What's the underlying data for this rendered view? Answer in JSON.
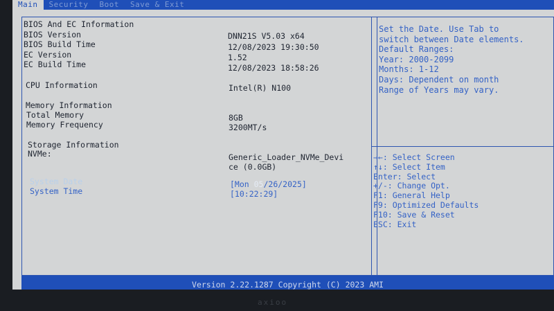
{
  "tabs": [
    {
      "label": "Main",
      "active": true
    },
    {
      "label": "Security",
      "active": false
    },
    {
      "label": "Boot",
      "active": false
    },
    {
      "label": "Save & Exit",
      "active": false
    }
  ],
  "main": {
    "bios_section": "BIOS And EC Information",
    "bios_version_label": "BIOS Version",
    "bios_version_value": "DNN21S V5.03 x64",
    "bios_build_label": "BIOS Build Time",
    "bios_build_value": "12/08/2023 19:30:50",
    "ec_version_label": "EC Version",
    "ec_version_value": "1.52",
    "ec_build_label": "EC Build Time",
    "ec_build_value": "12/08/2023 18:58:26",
    "cpu_label": "CPU Information",
    "cpu_value": "Intel(R) N100",
    "memory_section": "Memory Information",
    "total_memory_label": "Total Memory",
    "total_memory_value": "8GB",
    "memory_freq_label": "Memory Frequency",
    "memory_freq_value": "3200MT/s",
    "storage_section": "Storage Information",
    "nvme_label": "NVMe:",
    "nvme_value_line1": "Generic_Loader_NVMe_Devi",
    "nvme_value_line2": "ce (0.0GB)",
    "system_date_label": "System Date",
    "system_date_prefix": "[Mon ",
    "system_date_month": "05",
    "system_date_suffix": "/26/2025]",
    "system_time_label": "System Time",
    "system_time_value": "[10:22:29]"
  },
  "help": [
    "Set the Date. Use Tab to",
    "switch between Date elements.",
    "Default Ranges:",
    "Year: 2000-2099",
    "Months: 1-12",
    "Days: Dependent on month",
    "Range of Years may vary."
  ],
  "keys": [
    "→←: Select Screen",
    "↑↓: Select Item",
    "Enter: Select",
    "+/-: Change Opt.",
    "F1: General Help",
    "F9: Optimized Defaults",
    "F10: Save & Reset",
    "ESC: Exit"
  ],
  "footer": "Version 2.22.1287 Copyright (C) 2023 AMI",
  "bezel_logo": "axioo",
  "colors": {
    "accent": "#1f4fb8",
    "background": "#d3d5d6",
    "help_text": "#3462c6"
  }
}
